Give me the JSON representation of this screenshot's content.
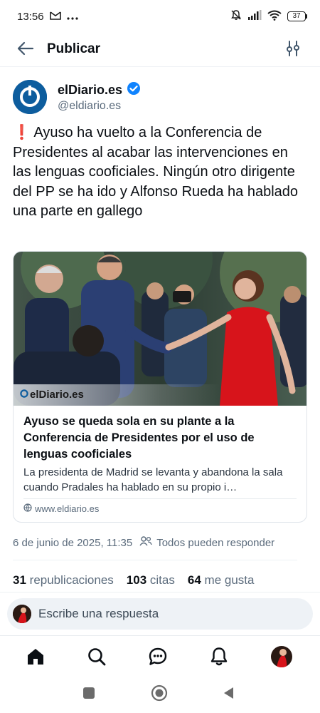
{
  "status_bar": {
    "time": "13:56",
    "icons": [
      "gmail-icon",
      "more-dots-icon",
      "mute-icon",
      "signal-icon",
      "wifi-icon"
    ],
    "battery": "37"
  },
  "header": {
    "title": "Publicar",
    "back_icon": "arrow-left-icon",
    "filter_icon": "sliders-icon"
  },
  "author": {
    "name": "elDiario.es",
    "handle": "@eldiario.es",
    "verified": true
  },
  "post": {
    "emoji": "❗",
    "text": " Ayuso ha vuelto a la Conferencia de Presidentes al acabar las intervenciones en las lenguas cooficiales. Ningún otro dirigente del PP se ha ido y Alfonso Rueda ha hablado una parte en gallego"
  },
  "link_card": {
    "watermark": "elDiario.es",
    "title": "Ayuso se queda sola en su plante a la Conferencia de Presidentes por el uso de lenguas cooficiales",
    "description": "La presidenta de Madrid se levanta y abandona la sala cuando Pradales ha hablado en su propio i…",
    "domain": "www.eldiario.es"
  },
  "meta": {
    "date": "6 de junio de 2025, 11:35",
    "audience": "Todos pueden responder"
  },
  "stats": {
    "reposts_count": "31",
    "reposts_label": "republicaciones",
    "quotes_count": "103",
    "quotes_label": "citas",
    "likes_count": "64",
    "likes_label": "me gusta"
  },
  "reply": {
    "placeholder": "Escribe una respuesta"
  },
  "nav": [
    "home-icon",
    "search-icon",
    "chat-icon",
    "bell-icon",
    "profile-avatar"
  ],
  "colors": {
    "accent": "#1083fe",
    "brand": "#0d5d9e",
    "muted": "#5b6b7c",
    "dress_red": "#d7141b"
  }
}
